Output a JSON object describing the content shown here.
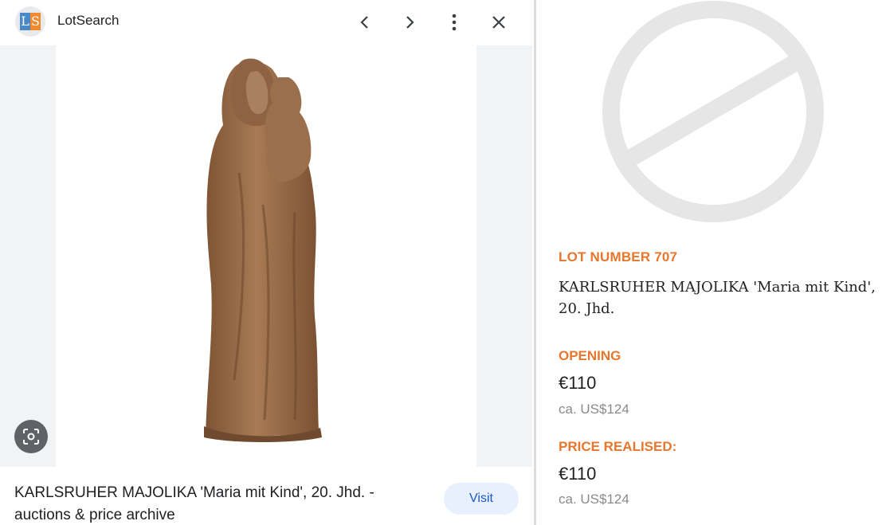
{
  "preview": {
    "site_name": "LotSearch",
    "logo_letters": [
      "L",
      "S"
    ],
    "caption": "KARLSRUHER MAJOLIKA 'Maria mit Kind', 20. Jhd. - auctions & price archive",
    "visit_label": "Visit",
    "icons": [
      "chevron-left-icon",
      "chevron-right-icon",
      "more-vert-icon",
      "close-icon",
      "lens-icon"
    ],
    "image_subject": "terracotta figurine of Madonna holding child"
  },
  "lot": {
    "lot_number": "LOT NUMBER 707",
    "title": "KARLSRUHER MAJOLIKA 'Maria mit Kind', 20. Jhd.",
    "opening_label": "OPENING",
    "opening_price": "€110",
    "opening_usd": "ca. US$124",
    "realised_label": "PRICE REALISED:",
    "realised_price": "€110",
    "realised_usd": "ca. US$124"
  },
  "colors": {
    "accent_orange": "#e8762c",
    "visit_bg": "#e8f0fe",
    "visit_text": "#1a57c8",
    "statue": "#9a6b49"
  }
}
